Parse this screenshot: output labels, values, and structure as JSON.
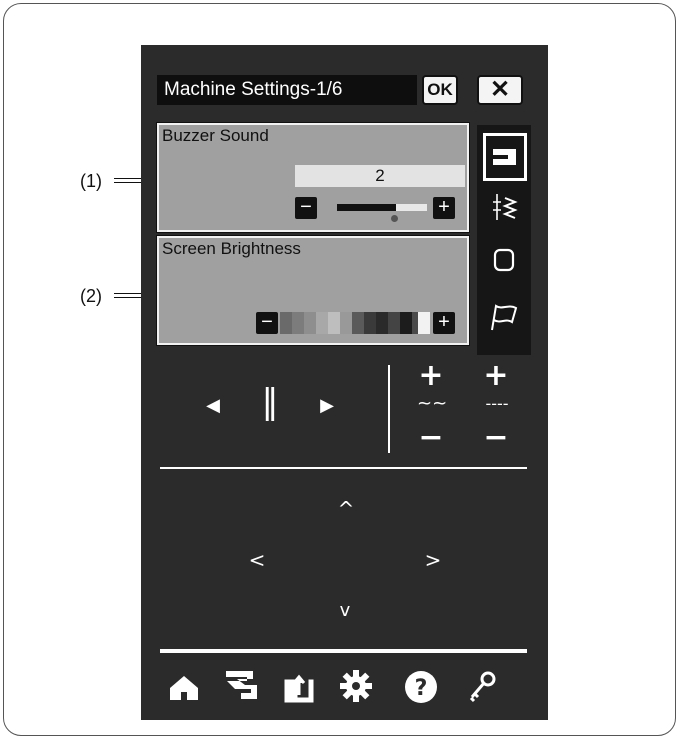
{
  "window": {
    "title": "Machine Settings-1/6",
    "ok_label": "OK",
    "close_label": "✕"
  },
  "callouts": {
    "c1": "(1)",
    "c2": "(2)"
  },
  "settings": {
    "buzzer": {
      "label": "Buzzer Sound",
      "value": "2",
      "minus": "−",
      "plus": "+",
      "level_fraction": 0.65
    },
    "brightness": {
      "label": "Screen Brightness",
      "minus": "−",
      "plus": "+"
    }
  },
  "sidebar": {
    "items": [
      "machine-icon",
      "stitch-icon",
      "bobbin-icon",
      "flag-icon"
    ]
  },
  "controls": {
    "left_arrow": "◀",
    "pause": "‖",
    "right_arrow": "▶",
    "plus": "+",
    "minus": "−",
    "zigzag": "~~",
    "dashes": "----",
    "up": "^",
    "down": "v",
    "left": "<",
    "right": ">"
  },
  "bottom_bar": {
    "icons": [
      "home-icon",
      "threading-icon",
      "export-icon",
      "settings-icon",
      "help-icon",
      "key-icon"
    ]
  }
}
